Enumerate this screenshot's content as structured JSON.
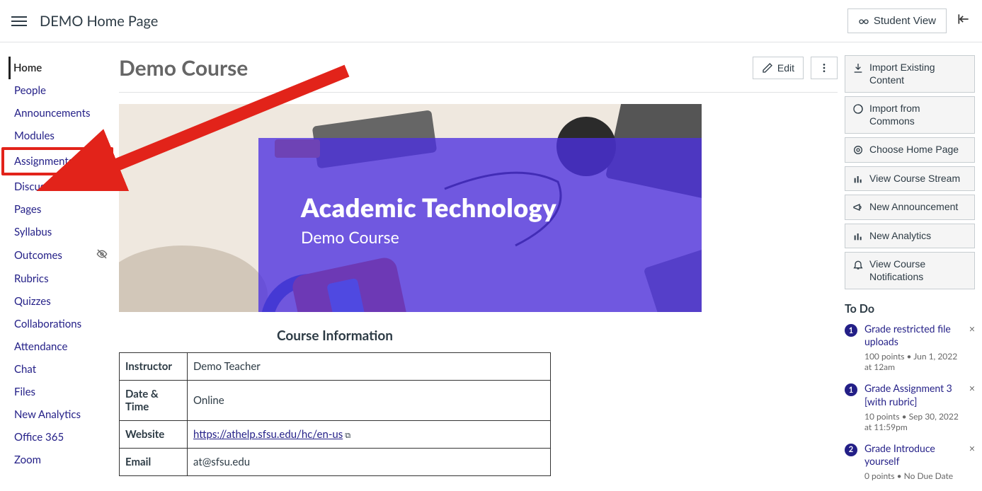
{
  "header": {
    "breadcrumb": "DEMO Home Page",
    "student_view": "Student View"
  },
  "nav": {
    "items": [
      {
        "label": "Home",
        "active": true
      },
      {
        "label": "People"
      },
      {
        "label": "Announcements"
      },
      {
        "label": "Modules"
      },
      {
        "label": "Assignments",
        "highlighted": true
      },
      {
        "label": "Discussions"
      },
      {
        "label": "Pages"
      },
      {
        "label": "Syllabus"
      },
      {
        "label": "Outcomes",
        "disabled_eye": true
      },
      {
        "label": "Rubrics"
      },
      {
        "label": "Quizzes"
      },
      {
        "label": "Collaborations"
      },
      {
        "label": "Attendance"
      },
      {
        "label": "Chat"
      },
      {
        "label": "Files"
      },
      {
        "label": "New Analytics"
      },
      {
        "label": "Office 365"
      },
      {
        "label": "Zoom"
      }
    ]
  },
  "main": {
    "course_title": "Demo Course",
    "edit_label": "Edit",
    "banner_title": "Academic Technology",
    "banner_sub": "Demo Course",
    "info_title": "Course Information",
    "info_rows": [
      {
        "label": "Instructor",
        "value": "Demo Teacher"
      },
      {
        "label": "Date & Time",
        "value": "Online"
      },
      {
        "label": "Website",
        "link": "https://athelp.sfsu.edu/hc/en-us"
      },
      {
        "label": "Email",
        "value": "at@sfsu.edu"
      }
    ]
  },
  "rail": {
    "buttons": [
      "Import Existing Content",
      "Import from Commons",
      "Choose Home Page",
      "View Course Stream",
      "New Announcement",
      "New Analytics",
      "View Course Notifications"
    ],
    "todo_title": "To Do",
    "todos": [
      {
        "badge": "1",
        "title": "Grade restricted file uploads",
        "meta": "100 points • Jun 1, 2022 at 12am"
      },
      {
        "badge": "1",
        "title": "Grade Assignment 3 [with rubric]",
        "meta": "10 points • Sep 30, 2022 at 11:59pm"
      },
      {
        "badge": "2",
        "title": "Grade Introduce yourself",
        "meta": "0 points • No Due Date"
      }
    ]
  }
}
